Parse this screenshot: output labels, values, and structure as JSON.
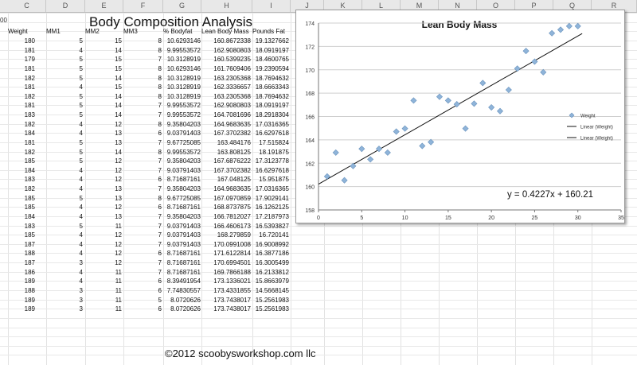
{
  "sheet": {
    "columns": [
      "C",
      "D",
      "E",
      "F",
      "G",
      "H",
      "I",
      "J",
      "K",
      "L",
      "M",
      "N",
      "O",
      "P",
      "Q",
      "R"
    ],
    "row_header_fragment": "00",
    "title": "Body Composition Analysis",
    "headers": [
      "Weight",
      "MM1",
      "MM2",
      "MM3",
      "% Bodyfat",
      "Lean Body Mass",
      "Pounds Fat"
    ],
    "rows": [
      [
        "180",
        "5",
        "15",
        "8",
        "10.6293146",
        "160.8672338",
        "19.1327662"
      ],
      [
        "181",
        "4",
        "14",
        "8",
        "9.99553572",
        "162.9080803",
        "18.0919197"
      ],
      [
        "179",
        "5",
        "15",
        "7",
        "10.3128919",
        "160.5399235",
        "18.4600765"
      ],
      [
        "181",
        "5",
        "15",
        "8",
        "10.6293146",
        "161.7609406",
        "19.2390594"
      ],
      [
        "182",
        "5",
        "14",
        "8",
        "10.3128919",
        "163.2305368",
        "18.7694632"
      ],
      [
        "181",
        "4",
        "15",
        "8",
        "10.3128919",
        "162.3336657",
        "18.6663343"
      ],
      [
        "182",
        "5",
        "14",
        "8",
        "10.3128919",
        "163.2305368",
        "18.7694632"
      ],
      [
        "181",
        "5",
        "14",
        "7",
        "9.99553572",
        "162.9080803",
        "18.0919197"
      ],
      [
        "183",
        "5",
        "14",
        "7",
        "9.99553572",
        "164.7081696",
        "18.2918304"
      ],
      [
        "182",
        "4",
        "12",
        "8",
        "9.35804203",
        "164.9683635",
        "17.0316365"
      ],
      [
        "184",
        "4",
        "13",
        "6",
        "9.03791403",
        "167.3702382",
        "16.6297618"
      ],
      [
        "181",
        "5",
        "13",
        "7",
        "9.67725085",
        "163.484176",
        "17.515824"
      ],
      [
        "182",
        "5",
        "14",
        "8",
        "9.99553572",
        "163.808125",
        "18.191875"
      ],
      [
        "185",
        "5",
        "12",
        "7",
        "9.35804203",
        "167.6876222",
        "17.3123778"
      ],
      [
        "184",
        "4",
        "12",
        "7",
        "9.03791403",
        "167.3702382",
        "16.6297618"
      ],
      [
        "183",
        "4",
        "12",
        "6",
        "8.71687161",
        "167.048125",
        "15.951875"
      ],
      [
        "182",
        "4",
        "13",
        "7",
        "9.35804203",
        "164.9683635",
        "17.0316365"
      ],
      [
        "185",
        "5",
        "13",
        "8",
        "9.67725085",
        "167.0970859",
        "17.9029141"
      ],
      [
        "185",
        "4",
        "12",
        "6",
        "8.71687161",
        "168.8737875",
        "16.1262125"
      ],
      [
        "184",
        "4",
        "13",
        "7",
        "9.35804203",
        "166.7812027",
        "17.2187973"
      ],
      [
        "183",
        "5",
        "11",
        "7",
        "9.03791403",
        "166.4606173",
        "16.5393827"
      ],
      [
        "185",
        "4",
        "12",
        "7",
        "9.03791403",
        "168.279859",
        "16.720141"
      ],
      [
        "187",
        "4",
        "12",
        "7",
        "9.03791403",
        "170.0991008",
        "16.9008992"
      ],
      [
        "188",
        "4",
        "12",
        "6",
        "8.71687161",
        "171.6122814",
        "16.3877186"
      ],
      [
        "187",
        "3",
        "12",
        "7",
        "8.71687161",
        "170.6994501",
        "16.3005499"
      ],
      [
        "186",
        "4",
        "11",
        "7",
        "8.71687161",
        "169.7866188",
        "16.2133812"
      ],
      [
        "189",
        "4",
        "11",
        "6",
        "8.39491954",
        "173.1336021",
        "15.8663979"
      ],
      [
        "188",
        "3",
        "11",
        "6",
        "7.74830557",
        "173.4331855",
        "14.5668145"
      ],
      [
        "189",
        "3",
        "11",
        "5",
        "8.0720626",
        "173.7438017",
        "15.2561983"
      ],
      [
        "189",
        "3",
        "11",
        "6",
        "8.0720626",
        "173.7438017",
        "15.2561983"
      ]
    ]
  },
  "chart_data": {
    "type": "scatter",
    "title": "Lean Body Mass",
    "xlim": [
      0,
      35
    ],
    "ylim": [
      158,
      174
    ],
    "x_ticks": [
      "0",
      "5",
      "10",
      "15",
      "20",
      "25",
      "30",
      "35"
    ],
    "y_ticks": [
      "158",
      "160",
      "162",
      "164",
      "166",
      "168",
      "170",
      "172",
      "174"
    ],
    "series": [
      {
        "name": "Weight",
        "color": "#8fb4d9",
        "x": [
          1,
          2,
          3,
          4,
          5,
          6,
          7,
          8,
          9,
          10,
          11,
          12,
          13,
          14,
          15,
          16,
          17,
          18,
          19,
          20,
          21,
          22,
          23,
          24,
          25,
          26,
          27,
          28,
          29,
          30
        ],
        "y": [
          160.87,
          162.91,
          160.54,
          161.76,
          163.23,
          162.33,
          163.23,
          162.91,
          164.71,
          164.97,
          167.37,
          163.48,
          163.81,
          167.69,
          167.37,
          167.05,
          164.97,
          167.1,
          168.87,
          166.78,
          166.46,
          168.28,
          170.1,
          171.61,
          170.7,
          169.79,
          173.13,
          173.43,
          173.74,
          173.74
        ]
      }
    ],
    "trendline": {
      "slope": 0.4227,
      "intercept": 160.21,
      "x_range": [
        0,
        30.5
      ],
      "color": "#111111"
    },
    "equation": "y = 0.4227x + 160.21",
    "legend": {
      "position": "right",
      "entries": [
        "Weight",
        "Linear (Weight)",
        "Linear (Weight)"
      ]
    },
    "grid": true
  },
  "footer": "©2012 scoobysworkshop.com llc"
}
